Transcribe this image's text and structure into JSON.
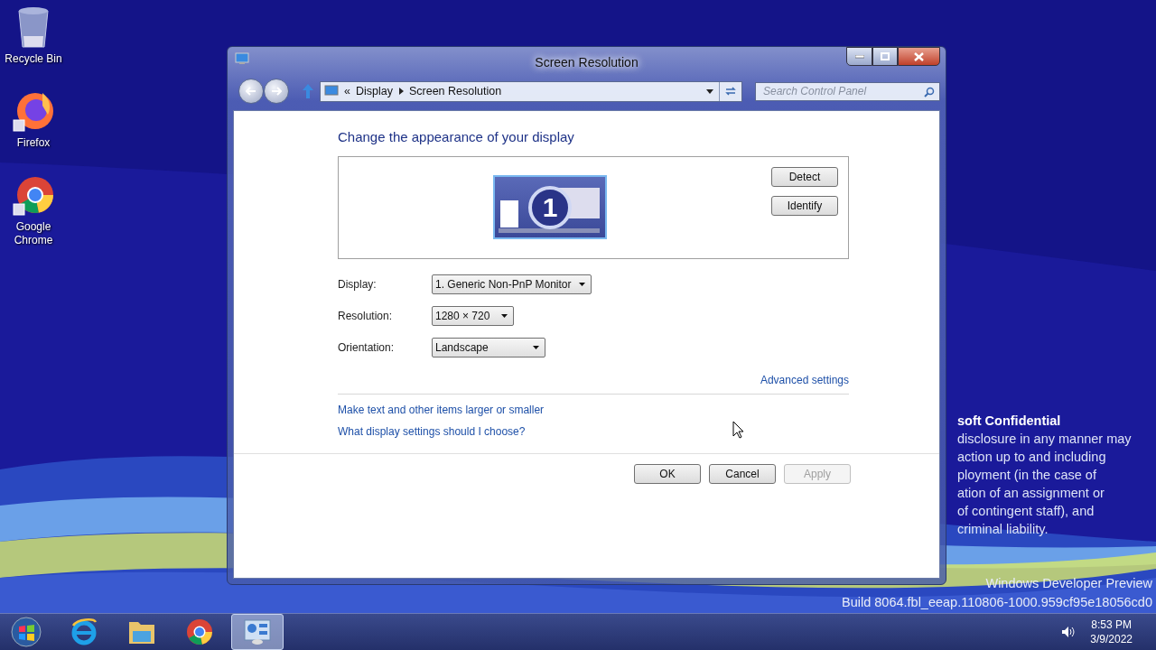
{
  "desktop_icons": [
    {
      "kind": "bin",
      "label": "Recycle Bin"
    },
    {
      "kind": "firefox",
      "label": "Firefox"
    },
    {
      "kind": "chrome",
      "label": "Google Chrome"
    }
  ],
  "confidential": {
    "title": "soft Confidential",
    "lines": [
      "disclosure in any manner may",
      "action up to and including",
      "ployment (in the case of",
      "ation of an assignment or",
      "of contingent staff), and",
      "criminal liability."
    ]
  },
  "edition": {
    "name": "Windows Developer Preview",
    "build": "Build 8064.fbl_eeap.110806-1000.959cf95e18056cd0"
  },
  "window": {
    "title": "Screen Resolution",
    "breadcrumb_prefix": "«",
    "breadcrumb": [
      "Display",
      "Screen Resolution"
    ],
    "search": {
      "placeholder": "Search Control Panel"
    },
    "heading": "Change the appearance of your display",
    "monitor_number": "1",
    "preview_buttons": [
      "Detect",
      "Identify"
    ],
    "settings": [
      {
        "label": "Display:",
        "value": "1. Generic Non-PnP Monitor"
      },
      {
        "label": "Resolution:",
        "value": "1280 × 720"
      },
      {
        "label": "Orientation:",
        "value": "Landscape"
      }
    ],
    "advanced_link": "Advanced settings",
    "links": [
      "Make text and other items larger or smaller",
      "What display settings should I choose?"
    ],
    "buttons": [
      {
        "label": "OK",
        "disabled": false
      },
      {
        "label": "Cancel",
        "disabled": false
      },
      {
        "label": "Apply",
        "disabled": true
      }
    ]
  },
  "taskbar": {
    "apps": [
      {
        "kind": "start",
        "selected": false
      },
      {
        "kind": "ie",
        "selected": false
      },
      {
        "kind": "explorer",
        "selected": false
      },
      {
        "kind": "chrome",
        "selected": false
      },
      {
        "kind": "control",
        "selected": true
      }
    ],
    "clock": {
      "time": "8:53 PM",
      "date": "3/9/2022"
    }
  }
}
